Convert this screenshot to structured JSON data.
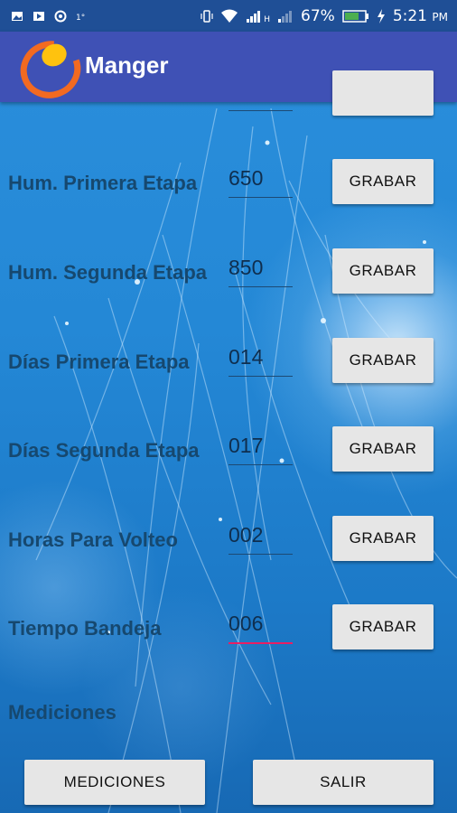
{
  "status_bar": {
    "network_type": "H",
    "battery_percent": "67%",
    "time": "5:21",
    "time_suffix": "PM"
  },
  "app_bar": {
    "title": "Manger"
  },
  "rows": [
    {
      "label": "Hum. Primera Etapa",
      "value": "650",
      "button": "GRABAR"
    },
    {
      "label": "Hum. Segunda Etapa",
      "value": "850",
      "button": "GRABAR"
    },
    {
      "label": "Días Primera Etapa",
      "value": "014",
      "button": "GRABAR"
    },
    {
      "label": "Días Segunda Etapa",
      "value": "017",
      "button": "GRABAR"
    },
    {
      "label": "Horas Para Volteo",
      "value": "002",
      "button": "GRABAR"
    },
    {
      "label": "Tiempo Bandeja",
      "value": "006",
      "button": "GRABAR"
    }
  ],
  "section_title": "Mediciones",
  "bottom_buttons": {
    "mediciones": "MEDICIONES",
    "salir": "SALIR"
  },
  "colors": {
    "status_bar": "#1f4f96",
    "app_bar": "#3f51b5",
    "label_text": "#16486f",
    "active_underline": "#e91e63",
    "button_bg": "#e6e6e6",
    "logo_orange": "#f26a21",
    "logo_yellow": "#ffc20e"
  }
}
